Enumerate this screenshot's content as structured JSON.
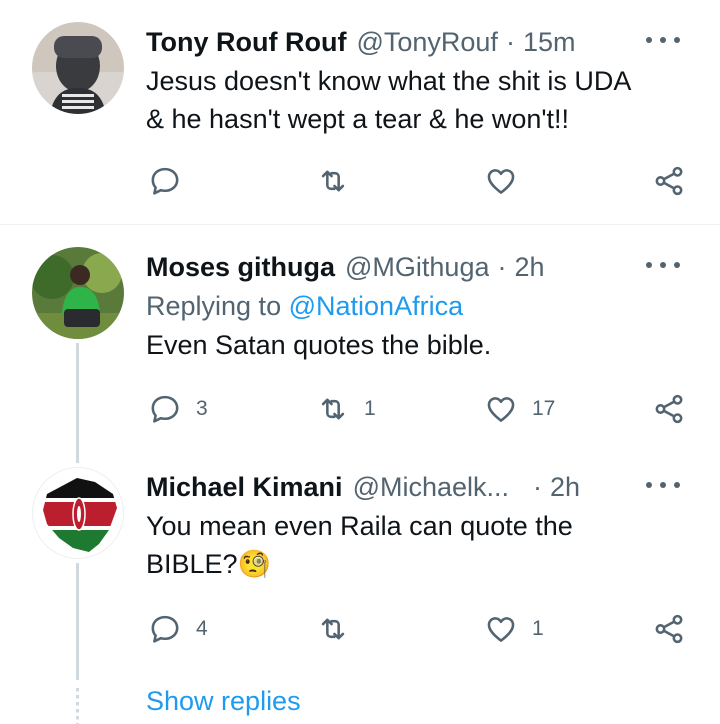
{
  "tweets": [
    {
      "name": "Tony Rouf Rouf",
      "handle": "@TonyRouf",
      "separator": "·",
      "time": "15m",
      "replying_label": "",
      "replying_to": "",
      "text_lines": [
        "Jesus doesn't know what the shit is UDA",
        "& he hasn't wept a tear & he won't!!"
      ],
      "reply_count": "",
      "retweet_count": "",
      "like_count": ""
    },
    {
      "name": "Moses githuga",
      "handle": "@MGithuga",
      "separator": "·",
      "time": "2h",
      "replying_label": "Replying to",
      "replying_to": "@NationAfrica",
      "text_lines": [
        "Even Satan quotes the bible."
      ],
      "reply_count": "3",
      "retweet_count": "1",
      "like_count": "17"
    },
    {
      "name": "Michael Kimani",
      "handle": "@Michaelk...",
      "separator": "·",
      "time": "2h",
      "text_lines": [
        "You mean even Raila can quote the",
        "BIBLE?🧐"
      ],
      "reply_count": "4",
      "retweet_count": "",
      "like_count": "1"
    }
  ],
  "show_replies": "Show replies",
  "colors": {
    "accent": "#1d9bf0",
    "secondary_text": "#536471",
    "primary_text": "#0f1419",
    "divider": "#eff3f4",
    "thread_line": "#cfd9de"
  },
  "icons": [
    "reply-icon",
    "retweet-icon",
    "like-icon",
    "share-icon",
    "more-icon"
  ]
}
